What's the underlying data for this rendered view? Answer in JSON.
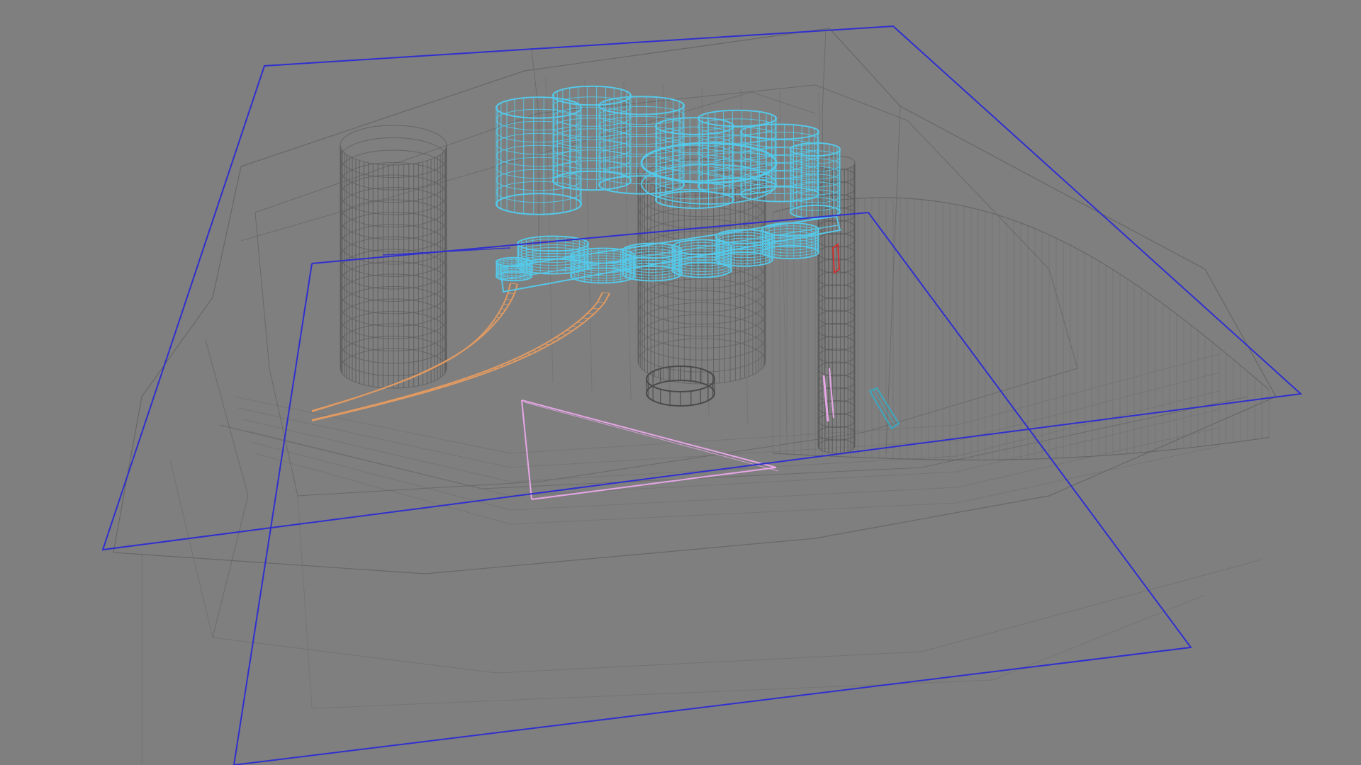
{
  "viewport": {
    "background": "#7f7f7f",
    "render_mode": "wireframe"
  },
  "colors": {
    "bounding_box": "#2f2fd0",
    "structure": "#626262",
    "structure_faint": "#6e6e6e",
    "cyan_mesh": "#55c8e8",
    "orange_rails": "#e09a62",
    "pink_triangle": "#e6a6e6",
    "red_accent": "#d03030",
    "teal_bar": "#3aa8c0"
  },
  "objects": [
    {
      "name": "bounding-box-upper",
      "type": "wire-box"
    },
    {
      "name": "bounding-box-lower",
      "type": "wire-box"
    },
    {
      "name": "stage-structure",
      "type": "wire-mesh"
    },
    {
      "name": "cylinder-left",
      "type": "wire-cylinder"
    },
    {
      "name": "cylinder-center",
      "type": "wire-cylinder"
    },
    {
      "name": "cylinder-right-column",
      "type": "wire-cylinder"
    },
    {
      "name": "curved-wall-right",
      "type": "wire-mesh"
    },
    {
      "name": "cyan-sculpture",
      "type": "wire-mesh",
      "selected": true
    },
    {
      "name": "orange-rails",
      "type": "curve"
    },
    {
      "name": "pink-triangle",
      "type": "curve"
    },
    {
      "name": "ring-base",
      "type": "wire-ring"
    },
    {
      "name": "teal-bar",
      "type": "wire-box"
    }
  ]
}
